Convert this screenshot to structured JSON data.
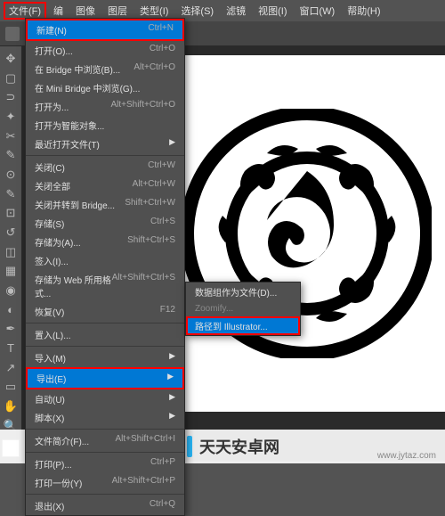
{
  "menubar": {
    "items": [
      "文件(F)",
      "编",
      "图像",
      "图层",
      "类型(I)",
      "选择(S)",
      "滤镜",
      "视图(I)",
      "窗口(W)",
      "帮助(H)"
    ]
  },
  "file_menu": {
    "items": [
      {
        "label": "新建(N)",
        "shortcut": "Ctrl+N",
        "boxed": true
      },
      {
        "label": "打开(O)...",
        "shortcut": "Ctrl+O"
      },
      {
        "label": "在 Bridge 中浏览(B)...",
        "shortcut": "Alt+Ctrl+O"
      },
      {
        "label": "在 Mini Bridge 中浏览(G)..."
      },
      {
        "label": "打开为...",
        "shortcut": "Alt+Shift+Ctrl+O"
      },
      {
        "label": "打开为智能对象..."
      },
      {
        "label": "最近打开文件(T)",
        "arrow": true
      },
      {
        "sep": true
      },
      {
        "label": "关闭(C)",
        "shortcut": "Ctrl+W"
      },
      {
        "label": "关闭全部",
        "shortcut": "Alt+Ctrl+W"
      },
      {
        "label": "关闭并转到 Bridge...",
        "shortcut": "Shift+Ctrl+W"
      },
      {
        "label": "存储(S)",
        "shortcut": "Ctrl+S"
      },
      {
        "label": "存储为(A)...",
        "shortcut": "Shift+Ctrl+S"
      },
      {
        "label": "签入(I)..."
      },
      {
        "label": "存储为 Web 所用格式...",
        "shortcut": "Alt+Shift+Ctrl+S"
      },
      {
        "label": "恢复(V)",
        "shortcut": "F12"
      },
      {
        "sep": true
      },
      {
        "label": "置入(L)..."
      },
      {
        "sep": true
      },
      {
        "label": "导入(M)",
        "arrow": true
      },
      {
        "label": "导出(E)",
        "arrow": true,
        "boxed": true,
        "selected": true
      },
      {
        "label": "自动(U)",
        "arrow": true
      },
      {
        "label": "脚本(X)",
        "arrow": true
      },
      {
        "sep": true
      },
      {
        "label": "文件简介(F)...",
        "shortcut": "Alt+Shift+Ctrl+I"
      },
      {
        "sep": true
      },
      {
        "label": "打印(P)...",
        "shortcut": "Ctrl+P"
      },
      {
        "label": "打印一份(Y)",
        "shortcut": "Alt+Shift+Ctrl+P"
      },
      {
        "sep": true
      },
      {
        "label": "退出(X)",
        "shortcut": "Ctrl+Q"
      }
    ]
  },
  "export_submenu": {
    "items": [
      {
        "label": "数据组作为文件(D)...",
        "dimmed": false
      },
      {
        "label": "Zoomify...",
        "dimmed": true
      },
      {
        "label": "路径到 Illustrator...",
        "highlighted": true
      }
    ]
  },
  "watermark": {
    "text": "天天安卓网",
    "url": "www.jytaz.com"
  }
}
